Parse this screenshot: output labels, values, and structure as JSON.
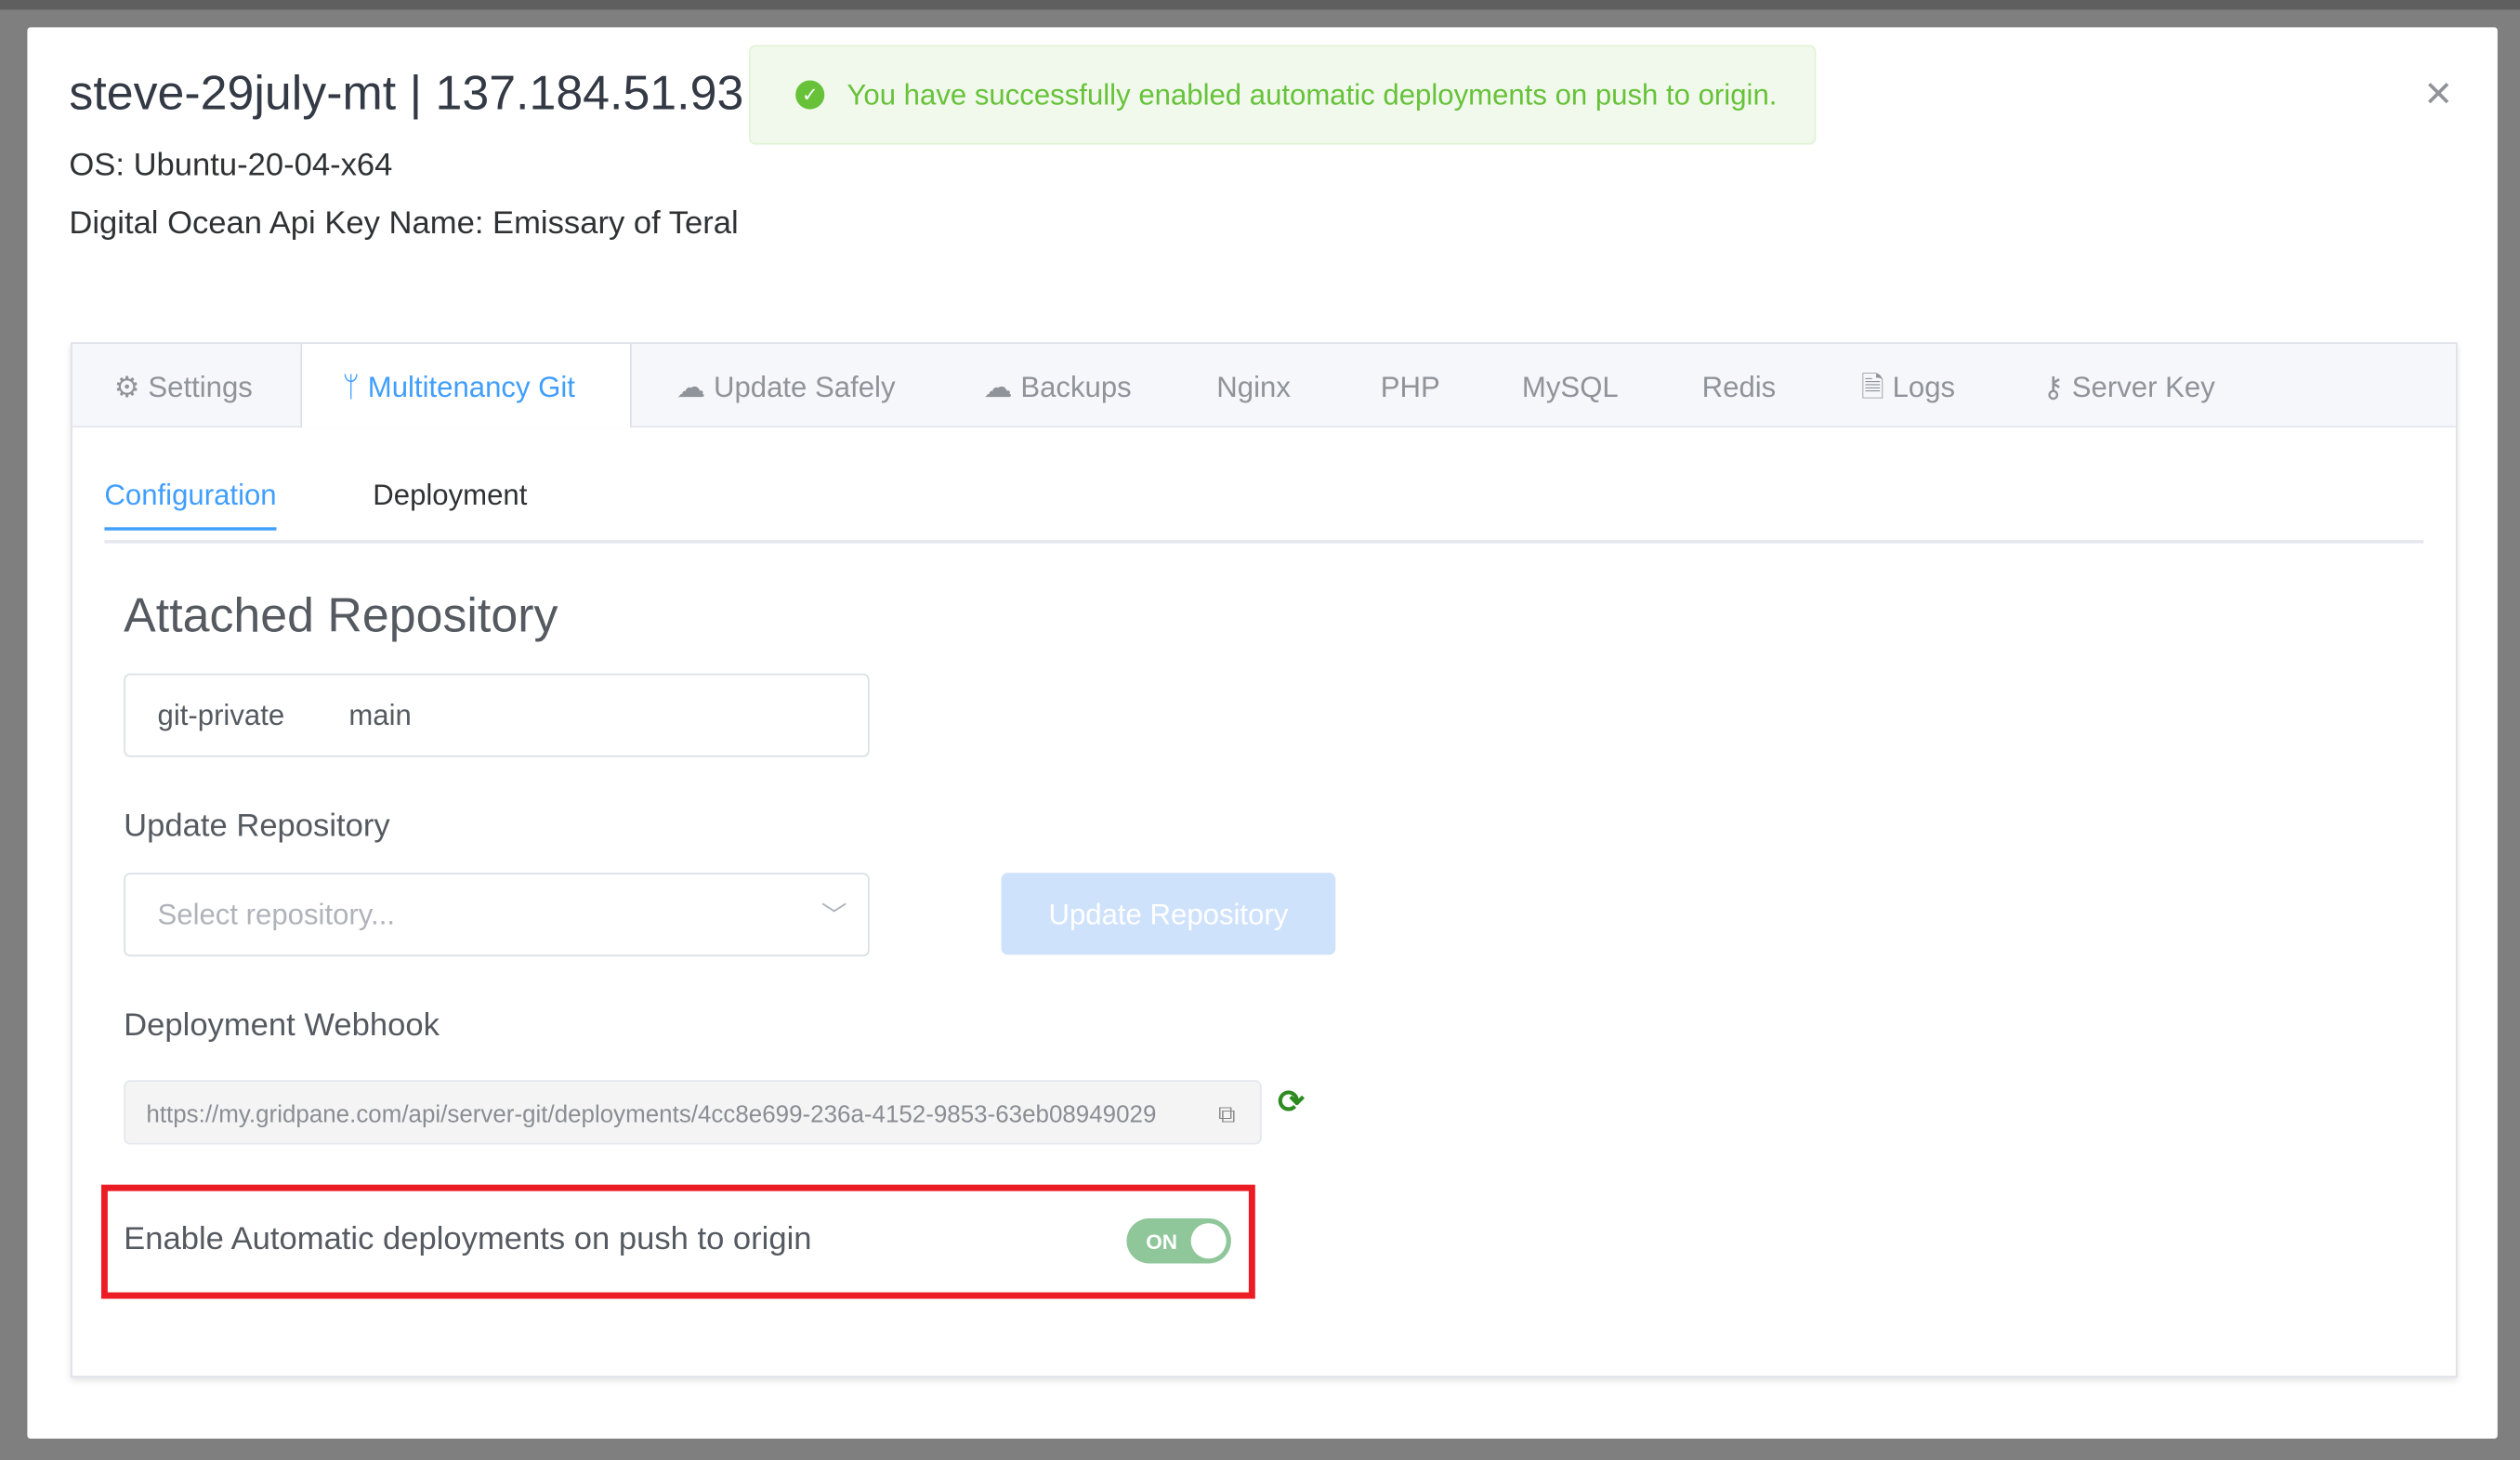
{
  "header": {
    "title": "steve-29july-mt | 137.184.51.93",
    "os": "OS: Ubuntu-20-04-x64",
    "api_key": "Digital Ocean Api Key Name: Emissary of Teral"
  },
  "toast": {
    "icon": "check-circle-icon",
    "message": "You have successfully enabled automatic deployments on push to origin.",
    "color": "#67c23a"
  },
  "tabs": [
    {
      "label": "Settings",
      "icon": "gear-icon"
    },
    {
      "label": "Multitenancy Git",
      "icon": "git-branch-icon",
      "active": true
    },
    {
      "label": "Update Safely",
      "icon": "cloud-upload-icon"
    },
    {
      "label": "Backups",
      "icon": "cloud-upload-icon"
    },
    {
      "label": "Nginx"
    },
    {
      "label": "PHP"
    },
    {
      "label": "MySQL"
    },
    {
      "label": "Redis"
    },
    {
      "label": "Logs",
      "icon": "document-icon"
    },
    {
      "label": "Server Key",
      "icon": "key-icon"
    }
  ],
  "subtabs": [
    {
      "label": "Configuration",
      "active": true
    },
    {
      "label": "Deployment"
    }
  ],
  "config": {
    "attached_heading": "Attached Repository",
    "attached_repo": "git-private",
    "attached_branch": "main",
    "update_label": "Update Repository",
    "select_placeholder": "Select repository...",
    "update_button": "Update Repository",
    "webhook_label": "Deployment Webhook",
    "webhook_url": "https://my.gridpane.com/api/server-git/deployments/4cc8e699-236a-4152-9853-63eb08949029",
    "auto_deploy_label": "Enable Automatic deployments on push to origin",
    "auto_deploy_state": "ON",
    "accent": "#409eff",
    "highlight": "#ec1c24"
  }
}
